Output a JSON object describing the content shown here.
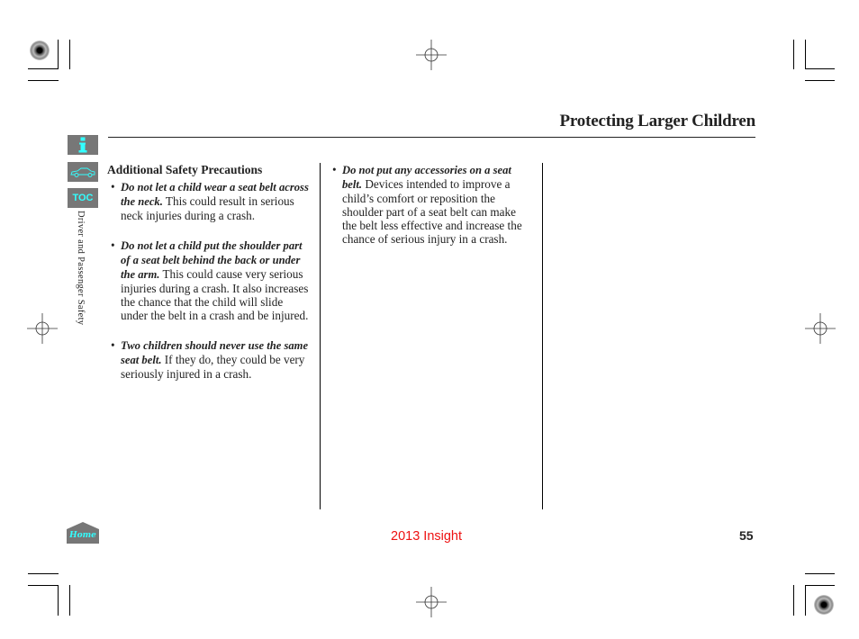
{
  "page": {
    "title": "Protecting Larger Children",
    "section_label": "Driver and Passenger Safety",
    "page_number": "55",
    "footer_model": "2013 Insight"
  },
  "nav": {
    "info_icon": "i",
    "car_icon": "car-icon",
    "toc_label": "TOC",
    "home_label": "Home"
  },
  "columns": {
    "left": {
      "heading": "Additional Safety Precautions",
      "items": [
        {
          "bullet": "•",
          "emphasis": "Do not let a child wear a seat belt across the neck.",
          "text": " This could result in serious neck injuries during a crash."
        },
        {
          "bullet": "•",
          "emphasis": "Do not let a child put the shoulder part of a seat belt behind the back or under the arm.",
          "text": " This could cause very serious injuries during a crash. It also increases the chance that the child will slide under the belt in a crash and be injured."
        },
        {
          "bullet": "•",
          "emphasis": "Two children should never use the same seat belt.",
          "text": " If they do, they could be very seriously injured in a crash."
        }
      ]
    },
    "middle": {
      "items": [
        {
          "bullet": "•",
          "emphasis": "Do not put any accessories on a seat belt.",
          "text": " Devices intended to improve a child’s comfort or reposition the shoulder part of a seat belt can make the belt less effective and increase the chance of serious injury in a crash."
        }
      ]
    }
  },
  "colors": {
    "nav_bg": "#777777",
    "nav_fg": "#33ffff",
    "footer_model": "#ee1111"
  }
}
